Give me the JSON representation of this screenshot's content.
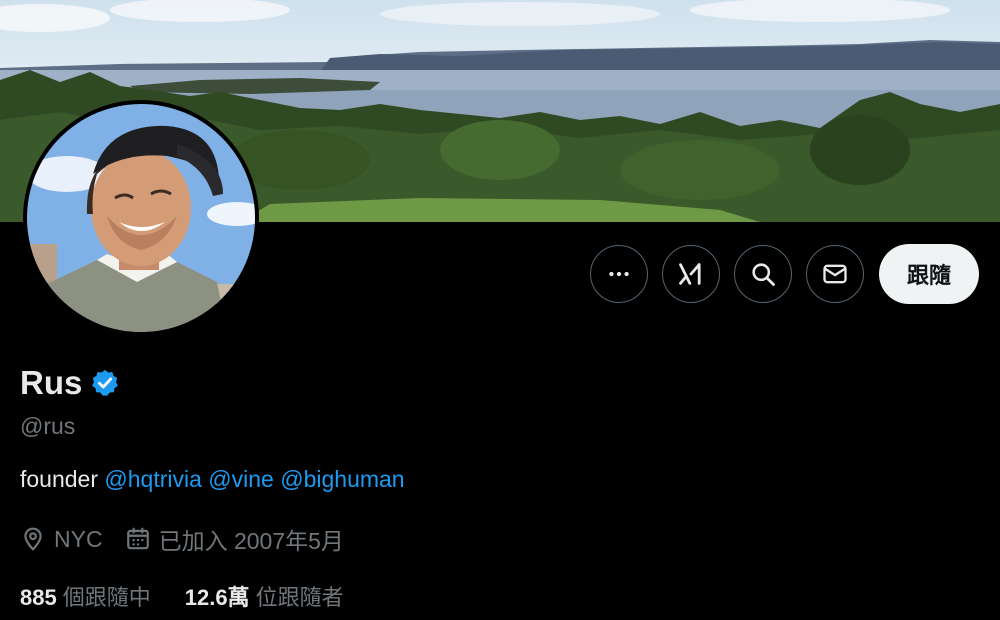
{
  "profile": {
    "display_name": "Rus",
    "handle": "@rus",
    "verified": true,
    "bio": {
      "prefix": "founder",
      "mentions": [
        "@hqtrivia",
        "@vine",
        "@bighuman"
      ]
    },
    "location": "NYC",
    "joined": "已加入 2007年5月",
    "following": {
      "count": "885",
      "label": "個跟隨中"
    },
    "followers": {
      "count": "12.6萬",
      "label": "位跟隨者"
    }
  },
  "actions": {
    "more_icon": "more-horizontal-icon",
    "grok_icon": "grok-icon",
    "search_icon": "search-icon",
    "message_icon": "envelope-icon",
    "follow_label": "跟隨"
  },
  "colors": {
    "background": "#000000",
    "link": "#1d9bf0",
    "verified": "#1d9bf0",
    "muted": "#71767b",
    "follow_button_bg": "#eff3f4"
  }
}
